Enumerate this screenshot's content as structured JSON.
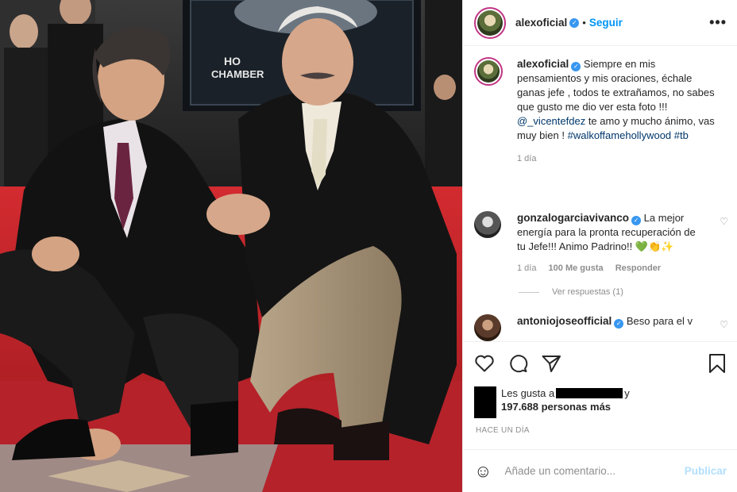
{
  "post": {
    "author": "alexoficial",
    "follow_label": "Seguir",
    "more_label": "•••"
  },
  "photo": {
    "banner_line1": "HO",
    "banner_line2": "CHAMBER          RCE"
  },
  "caption": {
    "username": "alexoficial",
    "text_part1": "Siempre en mis pensamientos y mis oraciones, échale ganas jefe , todos te extrañamos, no sabes que gusto me dio ver esta foto !!! ",
    "mention": "@_vicentefdez",
    "text_part2": " te amo y mucho ánimo, vas muy bien ! ",
    "hashtag1": "#walkoffamehollywood",
    "hashtag2": "#tb",
    "time": "1 día"
  },
  "comments": [
    {
      "username": "gonzalogarciavivanco",
      "text": "La mejor energía para la pronta recuperación de tu Jefe!!! Animo Padrino!! 💚👏✨",
      "time": "1 día",
      "likes": "100 Me gusta",
      "reply_label": "Responder",
      "view_replies": "Ver respuestas (1)"
    },
    {
      "username": "antoniojoseofficial",
      "text": "Beso para el v"
    }
  ],
  "likes": {
    "prefix": "Les gusta a",
    "suffix": "y",
    "count_text": "197.688 personas más"
  },
  "timestamp": "HACE UN DÍA",
  "composer": {
    "placeholder": "Añade un comentario...",
    "publish_label": "Publicar"
  },
  "colors": {
    "accent_blue": "#0095f6",
    "link_dark_blue": "#00376b",
    "muted": "#8e8e8e",
    "publish_disabled": "#b2dffc",
    "carpet_red": "#c8262a"
  },
  "icons": [
    "more-icon",
    "verified-icon",
    "heart-icon",
    "comment-icon",
    "share-icon",
    "bookmark-icon",
    "emoji-icon"
  ]
}
